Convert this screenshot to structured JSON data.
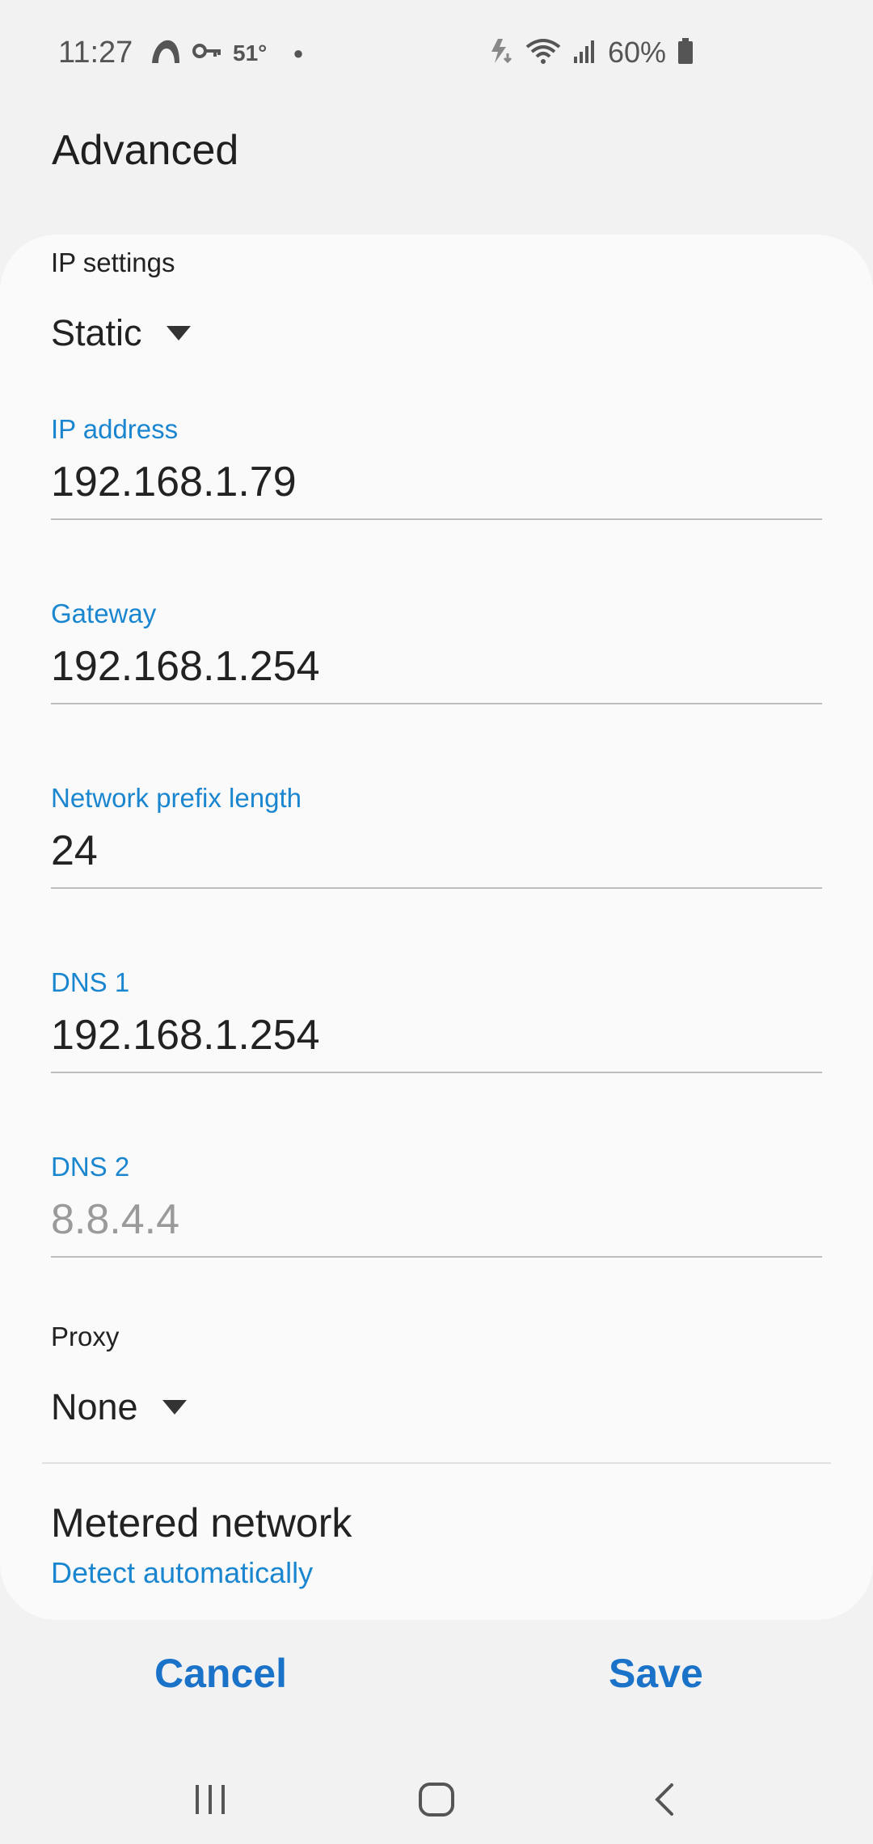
{
  "status_bar": {
    "time": "11:27",
    "temperature": "51°",
    "battery": "60%"
  },
  "header": {
    "title": "Advanced"
  },
  "ip_settings": {
    "label": "IP settings",
    "value": "Static"
  },
  "fields": {
    "ip_address": {
      "label": "IP address",
      "value": "192.168.1.79"
    },
    "gateway": {
      "label": "Gateway",
      "value": "192.168.1.254"
    },
    "prefix": {
      "label": "Network prefix length",
      "value": "24"
    },
    "dns1": {
      "label": "DNS 1",
      "value": "192.168.1.254"
    },
    "dns2": {
      "label": "DNS 2",
      "placeholder": "8.8.4.4"
    }
  },
  "proxy": {
    "label": "Proxy",
    "value": "None"
  },
  "metered": {
    "title": "Metered network",
    "value": "Detect automatically"
  },
  "actions": {
    "cancel": "Cancel",
    "save": "Save"
  },
  "colors": {
    "accent": "#1a86d0",
    "button": "#1a73c8",
    "background": "#f2f2f2",
    "card": "#fafafa"
  },
  "icons": [
    "weather-icon",
    "vpn-key-icon",
    "data-saver-icon",
    "wifi-icon",
    "signal-icon",
    "battery-icon",
    "recents-icon",
    "home-icon",
    "back-icon"
  ]
}
